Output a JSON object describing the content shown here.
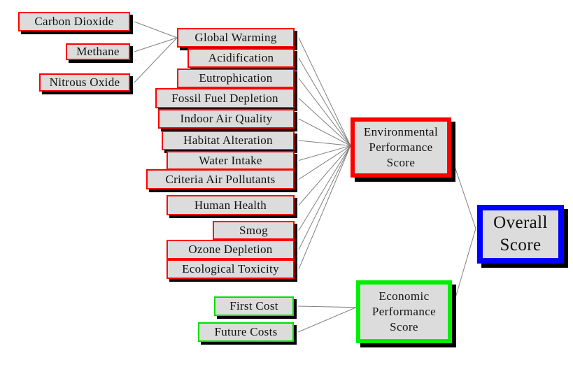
{
  "diagram": {
    "colors": {
      "environmental": "#ff0000",
      "economic": "#00ee00",
      "overall": "#0000ff",
      "box_fill": "#dcdcdc",
      "shadow": "#000000",
      "connector": "#808080"
    },
    "ghg_sources": [
      {
        "id": "carbon-dioxide",
        "label": "Carbon Dioxide"
      },
      {
        "id": "methane",
        "label": "Methane"
      },
      {
        "id": "nitrous-oxide",
        "label": "Nitrous Oxide"
      }
    ],
    "environmental_impacts": [
      {
        "id": "global-warming",
        "label": "Global Warming"
      },
      {
        "id": "acidification",
        "label": "Acidification"
      },
      {
        "id": "eutrophication",
        "label": "Eutrophication"
      },
      {
        "id": "fossil-fuel-depletion",
        "label": "Fossil Fuel Depletion"
      },
      {
        "id": "indoor-air-quality",
        "label": "Indoor Air Quality"
      },
      {
        "id": "habitat-alteration",
        "label": "Habitat Alteration"
      },
      {
        "id": "water-intake",
        "label": "Water Intake"
      },
      {
        "id": "criteria-air-pollutants",
        "label": "Criteria Air Pollutants"
      },
      {
        "id": "human-health",
        "label": "Human Health"
      },
      {
        "id": "smog",
        "label": "Smog"
      },
      {
        "id": "ozone-depletion",
        "label": "Ozone Depletion"
      },
      {
        "id": "ecological-toxicity",
        "label": "Ecological Toxicity"
      }
    ],
    "economic_costs": [
      {
        "id": "first-cost",
        "label": "First Cost"
      },
      {
        "id": "future-costs",
        "label": "Future Costs"
      }
    ],
    "environmental_score": {
      "lines": [
        "Environmental",
        "Performance",
        "Score"
      ]
    },
    "economic_score": {
      "lines": [
        "Economic",
        "Performance",
        "Score"
      ]
    },
    "overall_score": {
      "lines": [
        "Overall",
        "Score"
      ]
    },
    "edges": [
      [
        "carbon-dioxide",
        "global-warming"
      ],
      [
        "methane",
        "global-warming"
      ],
      [
        "nitrous-oxide",
        "global-warming"
      ],
      [
        "global-warming",
        "environmental-score"
      ],
      [
        "acidification",
        "environmental-score"
      ],
      [
        "eutrophication",
        "environmental-score"
      ],
      [
        "fossil-fuel-depletion",
        "environmental-score"
      ],
      [
        "indoor-air-quality",
        "environmental-score"
      ],
      [
        "habitat-alteration",
        "environmental-score"
      ],
      [
        "water-intake",
        "environmental-score"
      ],
      [
        "criteria-air-pollutants",
        "environmental-score"
      ],
      [
        "human-health",
        "environmental-score"
      ],
      [
        "smog",
        "environmental-score"
      ],
      [
        "ozone-depletion",
        "environmental-score"
      ],
      [
        "ecological-toxicity",
        "environmental-score"
      ],
      [
        "first-cost",
        "economic-score"
      ],
      [
        "future-costs",
        "economic-score"
      ],
      [
        "environmental-score",
        "overall-score"
      ],
      [
        "economic-score",
        "overall-score"
      ]
    ]
  }
}
